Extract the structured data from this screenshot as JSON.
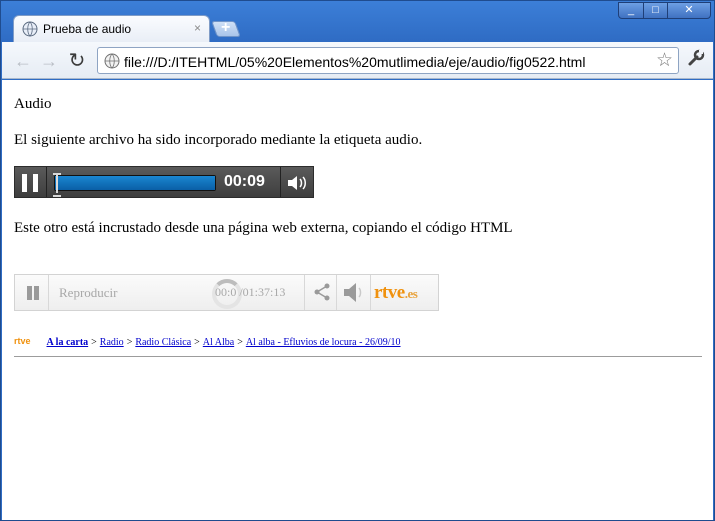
{
  "browser": {
    "tab_title": "Prueba de audio",
    "tab_close": "×",
    "new_tab": "+",
    "window_buttons": {
      "minimize": "_",
      "maximize": "□",
      "close": "✕"
    },
    "nav": {
      "back": "←",
      "forward": "→",
      "reload": "↻"
    },
    "address": "file:///D:/ITEHTML/05%20Elementos%20mutlimedia/eje/audio/fig0522.html",
    "star": "☆",
    "wrench": "🔧"
  },
  "page": {
    "heading": "Audio",
    "intro": "El siguiente archivo ha sido incorporado mediante la etiqueta audio.",
    "embed_text": "Este otro está incrustado desde una página web externa, copiando el código HTML"
  },
  "audio_player": {
    "time": "00:09",
    "progress": 1.0
  },
  "rtve_player": {
    "title": "Reproducir",
    "time": "00:0 /01:37:13",
    "logo_main": "rtve",
    "logo_suffix": ".es"
  },
  "breadcrumb": {
    "logo": "rtve",
    "items": [
      {
        "label": "A la carta"
      },
      {
        "label": "Radio"
      },
      {
        "label": "Radio Clásica"
      },
      {
        "label": "Al Alba"
      },
      {
        "label": "Al alba - Efluvios de locura - 26/09/10"
      }
    ],
    "separator": ">"
  },
  "colors": {
    "window_frame": "#2f6cc4",
    "audio_fill": "#0a5fa6",
    "rtve_orange": "#f0920f",
    "link": "#0000cc"
  }
}
